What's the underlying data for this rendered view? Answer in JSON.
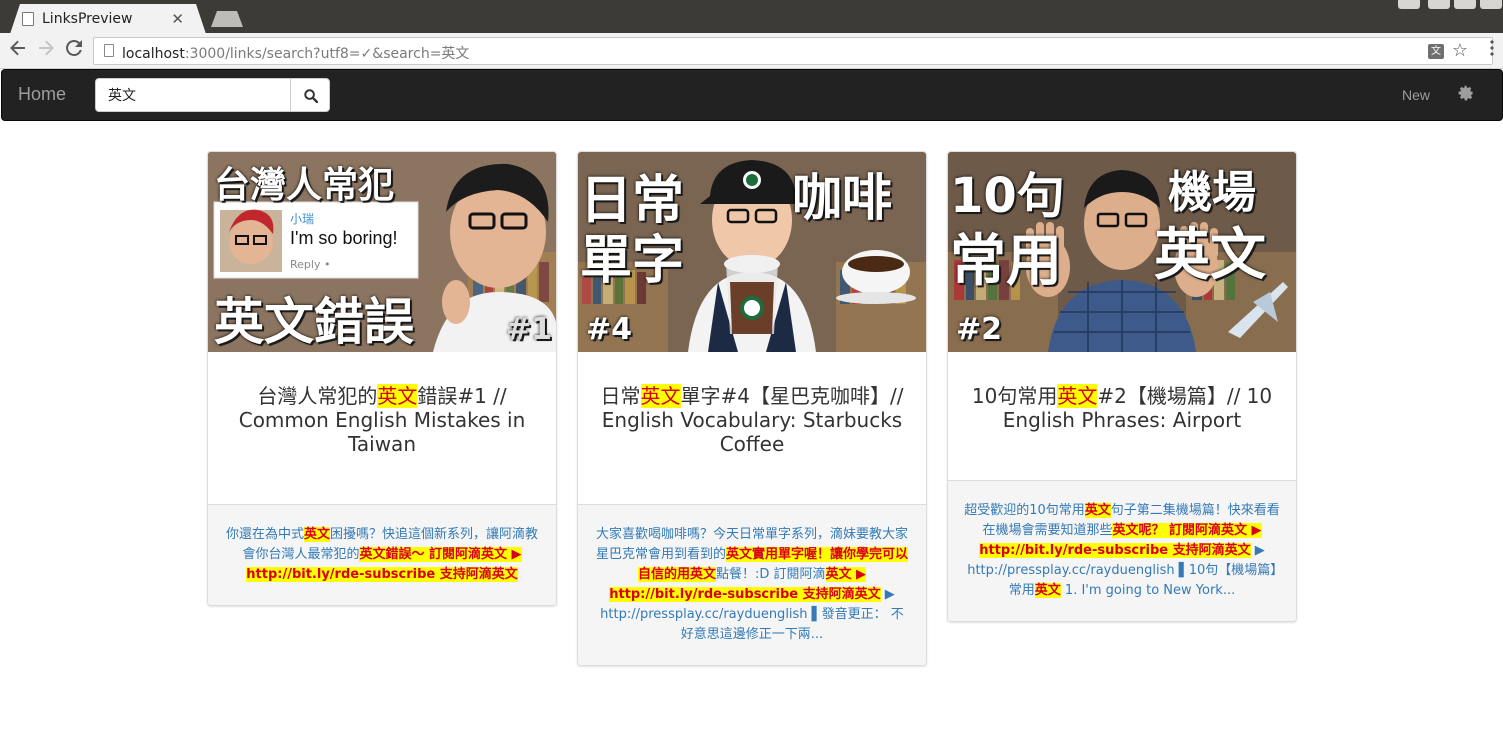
{
  "browser": {
    "tab_title": "LinksPreview",
    "url_host": "localhost",
    "url_path": ":3000/links/search?utf8=✓&search=英文"
  },
  "navbar": {
    "brand": "Home",
    "search_value": "英文",
    "new_label": "New"
  },
  "cards": [
    {
      "thumb": {
        "line1": "台灣人常犯",
        "line2": "英文錯誤",
        "badge": "#1",
        "comment_user": "小瑞",
        "comment_text": "I'm so boring!",
        "comment_reply": "Reply •"
      },
      "title_pre": "台灣人常犯的",
      "title_hl": "英文",
      "title_post": "錯誤#1 // Common English Mistakes in Taiwan",
      "desc": [
        {
          "t": "你還在為中式",
          "h": false
        },
        {
          "t": "英文",
          "h": true
        },
        {
          "t": "困擾嗎？快追這個新系列，讓阿滴教會你台灣人最常犯的",
          "h": false
        },
        {
          "t": "英文錯誤～ 訂閱阿滴英文 ▶ http://bit.ly/rde-subscribe 支持阿滴英文",
          "h": true
        }
      ]
    },
    {
      "thumb": {
        "line1": "日常",
        "line2": "單字",
        "line3": "咖啡",
        "badge": "#4"
      },
      "title_pre": "日常",
      "title_hl": "英文",
      "title_post": "單字#4【星巴克咖啡】// English Vocabulary: Starbucks Coffee",
      "desc": [
        {
          "t": "大家喜歡喝咖啡嗎？今天日常單字系列，滴妹要教大家星巴克常會用到看到的",
          "h": false
        },
        {
          "t": "英文實用單字喔！讓你學完可以自信的用英文",
          "h": true
        },
        {
          "t": "點餐！:D 訂閱阿滴",
          "h": false
        },
        {
          "t": "英文 ▶ http://bit.ly/rde-subscribe 支持阿滴英文",
          "h": true
        },
        {
          "t": " ▶ http://pressplay.cc/rayduenglish ▌發音更正： 不好意思這邊修正一下兩...",
          "h": false
        }
      ]
    },
    {
      "thumb": {
        "line1": "10句",
        "line2": "常用",
        "line3": "機場",
        "line4": "英文",
        "badge": "#2"
      },
      "title_pre": "10句常用",
      "title_hl": "英文",
      "title_post": "#2【機場篇】// 10 English Phrases: Airport",
      "desc": [
        {
          "t": "超受歡迎的10句常用",
          "h": false
        },
        {
          "t": "英文",
          "h": true
        },
        {
          "t": "句子第二集機場篇！快來看看在機場會需要知道那些",
          "h": false
        },
        {
          "t": "英文呢？ 訂閱阿滴英文 ▶ http://bit.ly/rde-subscribe 支持阿滴英文",
          "h": true
        },
        {
          "t": " ▶ http://pressplay.cc/rayduenglish ▌10句【機場篇】常用",
          "h": false
        },
        {
          "t": "英文",
          "h": true
        },
        {
          "t": " 1. I'm going to New York...",
          "h": false
        }
      ]
    }
  ],
  "colors": {
    "highlight_bg": "#ffff00",
    "highlight_text": "#d9001b",
    "link": "#337ab7",
    "navbar_bg": "#222222"
  }
}
